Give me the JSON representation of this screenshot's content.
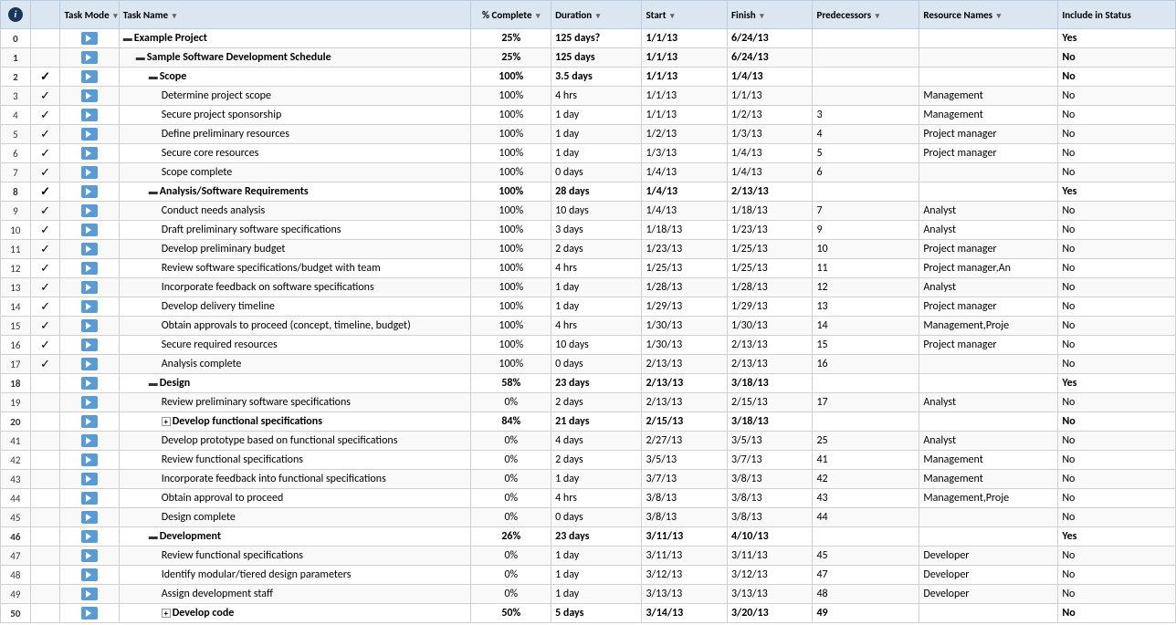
{
  "header": {
    "cols": [
      {
        "id": "col-id",
        "label": ""
      },
      {
        "id": "col-info",
        "label": ""
      },
      {
        "id": "col-task-mode",
        "label": "Task Mode"
      },
      {
        "id": "col-task-name",
        "label": "Task Name"
      },
      {
        "id": "col-pct",
        "label": "% Complete"
      },
      {
        "id": "col-duration",
        "label": "Duration"
      },
      {
        "id": "col-start",
        "label": "Start"
      },
      {
        "id": "col-finish",
        "label": "Finish"
      },
      {
        "id": "col-predecessors",
        "label": "Predecessors"
      },
      {
        "id": "col-resource",
        "label": "Resource Names"
      },
      {
        "id": "col-include",
        "label": "Include in Status"
      }
    ]
  },
  "rows": [
    {
      "id": "0",
      "check": "",
      "mode": "auto",
      "indent": 0,
      "collapse": true,
      "expand_box": false,
      "name": "Example Project",
      "pct": "25%",
      "duration": "125 days?",
      "start": "1/1/13",
      "finish": "6/24/13",
      "predecessors": "",
      "resource": "",
      "include": "Yes",
      "bold": true
    },
    {
      "id": "1",
      "check": "",
      "mode": "auto",
      "indent": 1,
      "collapse": true,
      "expand_box": false,
      "name": "Sample Software Development Schedule",
      "pct": "25%",
      "duration": "125 days",
      "start": "1/1/13",
      "finish": "6/24/13",
      "predecessors": "",
      "resource": "",
      "include": "No",
      "bold": true
    },
    {
      "id": "2",
      "check": "✓",
      "mode": "auto",
      "indent": 2,
      "collapse": true,
      "expand_box": false,
      "name": "Scope",
      "pct": "100%",
      "duration": "3.5 days",
      "start": "1/1/13",
      "finish": "1/4/13",
      "predecessors": "",
      "resource": "",
      "include": "No",
      "bold": true
    },
    {
      "id": "3",
      "check": "✓",
      "mode": "auto",
      "indent": 3,
      "collapse": false,
      "expand_box": false,
      "name": "Determine project scope",
      "pct": "100%",
      "duration": "4 hrs",
      "start": "1/1/13",
      "finish": "1/1/13",
      "predecessors": "",
      "resource": "Management",
      "include": "No",
      "bold": false
    },
    {
      "id": "4",
      "check": "✓",
      "mode": "auto",
      "indent": 3,
      "collapse": false,
      "expand_box": false,
      "name": "Secure project sponsorship",
      "pct": "100%",
      "duration": "1 day",
      "start": "1/1/13",
      "finish": "1/2/13",
      "predecessors": "3",
      "resource": "Management",
      "include": "No",
      "bold": false
    },
    {
      "id": "5",
      "check": "✓",
      "mode": "auto",
      "indent": 3,
      "collapse": false,
      "expand_box": false,
      "name": "Define preliminary resources",
      "pct": "100%",
      "duration": "1 day",
      "start": "1/2/13",
      "finish": "1/3/13",
      "predecessors": "4",
      "resource": "Project manager",
      "include": "No",
      "bold": false
    },
    {
      "id": "6",
      "check": "✓",
      "mode": "auto",
      "indent": 3,
      "collapse": false,
      "expand_box": false,
      "name": "Secure core resources",
      "pct": "100%",
      "duration": "1 day",
      "start": "1/3/13",
      "finish": "1/4/13",
      "predecessors": "5",
      "resource": "Project manager",
      "include": "No",
      "bold": false
    },
    {
      "id": "7",
      "check": "✓",
      "mode": "auto",
      "indent": 3,
      "collapse": false,
      "expand_box": false,
      "name": "Scope complete",
      "pct": "100%",
      "duration": "0 days",
      "start": "1/4/13",
      "finish": "1/4/13",
      "predecessors": "6",
      "resource": "",
      "include": "No",
      "bold": false
    },
    {
      "id": "8",
      "check": "✓",
      "mode": "auto",
      "indent": 2,
      "collapse": true,
      "expand_box": false,
      "name": "Analysis/Software Requirements",
      "pct": "100%",
      "duration": "28 days",
      "start": "1/4/13",
      "finish": "2/13/13",
      "predecessors": "",
      "resource": "",
      "include": "Yes",
      "bold": true
    },
    {
      "id": "9",
      "check": "✓",
      "mode": "auto",
      "indent": 3,
      "collapse": false,
      "expand_box": false,
      "name": "Conduct needs analysis",
      "pct": "100%",
      "duration": "10 days",
      "start": "1/4/13",
      "finish": "1/18/13",
      "predecessors": "7",
      "resource": "Analyst",
      "include": "No",
      "bold": false
    },
    {
      "id": "10",
      "check": "✓",
      "mode": "auto",
      "indent": 3,
      "collapse": false,
      "expand_box": false,
      "name": "Draft preliminary software specifications",
      "pct": "100%",
      "duration": "3 days",
      "start": "1/18/13",
      "finish": "1/23/13",
      "predecessors": "9",
      "resource": "Analyst",
      "include": "No",
      "bold": false
    },
    {
      "id": "11",
      "check": "✓",
      "mode": "auto",
      "indent": 3,
      "collapse": false,
      "expand_box": false,
      "name": "Develop preliminary budget",
      "pct": "100%",
      "duration": "2 days",
      "start": "1/23/13",
      "finish": "1/25/13",
      "predecessors": "10",
      "resource": "Project manager",
      "include": "No",
      "bold": false
    },
    {
      "id": "12",
      "check": "✓",
      "mode": "auto",
      "indent": 3,
      "collapse": false,
      "expand_box": false,
      "name": "Review software specifications/budget with team",
      "pct": "100%",
      "duration": "4 hrs",
      "start": "1/25/13",
      "finish": "1/25/13",
      "predecessors": "11",
      "resource": "Project manager,An",
      "include": "No",
      "bold": false
    },
    {
      "id": "13",
      "check": "✓",
      "mode": "auto",
      "indent": 3,
      "collapse": false,
      "expand_box": false,
      "name": "Incorporate feedback on software specifications",
      "pct": "100%",
      "duration": "1 day",
      "start": "1/28/13",
      "finish": "1/28/13",
      "predecessors": "12",
      "resource": "Analyst",
      "include": "No",
      "bold": false
    },
    {
      "id": "14",
      "check": "✓",
      "mode": "auto",
      "indent": 3,
      "collapse": false,
      "expand_box": false,
      "name": "Develop delivery timeline",
      "pct": "100%",
      "duration": "1 day",
      "start": "1/29/13",
      "finish": "1/29/13",
      "predecessors": "13",
      "resource": "Project manager",
      "include": "No",
      "bold": false
    },
    {
      "id": "15",
      "check": "✓",
      "mode": "auto",
      "indent": 3,
      "collapse": false,
      "expand_box": false,
      "name": "Obtain approvals to proceed (concept, timeline, budget)",
      "pct": "100%",
      "duration": "4 hrs",
      "start": "1/30/13",
      "finish": "1/30/13",
      "predecessors": "14",
      "resource": "Management,Proje",
      "include": "No",
      "bold": false
    },
    {
      "id": "16",
      "check": "✓",
      "mode": "auto",
      "indent": 3,
      "collapse": false,
      "expand_box": false,
      "name": "Secure required resources",
      "pct": "100%",
      "duration": "10 days",
      "start": "1/30/13",
      "finish": "2/13/13",
      "predecessors": "15",
      "resource": "Project manager",
      "include": "No",
      "bold": false
    },
    {
      "id": "17",
      "check": "✓",
      "mode": "auto",
      "indent": 3,
      "collapse": false,
      "expand_box": false,
      "name": "Analysis complete",
      "pct": "100%",
      "duration": "0 days",
      "start": "2/13/13",
      "finish": "2/13/13",
      "predecessors": "16",
      "resource": "",
      "include": "No",
      "bold": false
    },
    {
      "id": "18",
      "check": "",
      "mode": "auto",
      "indent": 2,
      "collapse": true,
      "expand_box": false,
      "name": "Design",
      "pct": "58%",
      "duration": "23 days",
      "start": "2/13/13",
      "finish": "3/18/13",
      "predecessors": "",
      "resource": "",
      "include": "Yes",
      "bold": true
    },
    {
      "id": "19",
      "check": "",
      "mode": "auto",
      "indent": 3,
      "collapse": false,
      "expand_box": false,
      "name": "Review preliminary software specifications",
      "pct": "0%",
      "duration": "2 days",
      "start": "2/13/13",
      "finish": "2/15/13",
      "predecessors": "17",
      "resource": "Analyst",
      "include": "No",
      "bold": false
    },
    {
      "id": "20",
      "check": "",
      "mode": "auto",
      "indent": 3,
      "collapse": false,
      "expand_box": true,
      "name": "Develop functional specifications",
      "pct": "84%",
      "duration": "21 days",
      "start": "2/15/13",
      "finish": "3/18/13",
      "predecessors": "",
      "resource": "",
      "include": "No",
      "bold": true
    },
    {
      "id": "41",
      "check": "",
      "mode": "auto",
      "indent": 3,
      "collapse": false,
      "expand_box": false,
      "name": "Develop prototype based on functional specifications",
      "pct": "0%",
      "duration": "4 days",
      "start": "2/27/13",
      "finish": "3/5/13",
      "predecessors": "25",
      "resource": "Analyst",
      "include": "No",
      "bold": false
    },
    {
      "id": "42",
      "check": "",
      "mode": "auto",
      "indent": 3,
      "collapse": false,
      "expand_box": false,
      "name": "Review functional specifications",
      "pct": "0%",
      "duration": "2 days",
      "start": "3/5/13",
      "finish": "3/7/13",
      "predecessors": "41",
      "resource": "Management",
      "include": "No",
      "bold": false
    },
    {
      "id": "43",
      "check": "",
      "mode": "auto",
      "indent": 3,
      "collapse": false,
      "expand_box": false,
      "name": "Incorporate feedback into functional specifications",
      "pct": "0%",
      "duration": "1 day",
      "start": "3/7/13",
      "finish": "3/8/13",
      "predecessors": "42",
      "resource": "Management",
      "include": "No",
      "bold": false
    },
    {
      "id": "44",
      "check": "",
      "mode": "auto",
      "indent": 3,
      "collapse": false,
      "expand_box": false,
      "name": "Obtain approval to proceed",
      "pct": "0%",
      "duration": "4 hrs",
      "start": "3/8/13",
      "finish": "3/8/13",
      "predecessors": "43",
      "resource": "Management,Proje",
      "include": "No",
      "bold": false
    },
    {
      "id": "45",
      "check": "",
      "mode": "auto",
      "indent": 3,
      "collapse": false,
      "expand_box": false,
      "name": "Design complete",
      "pct": "0%",
      "duration": "0 days",
      "start": "3/8/13",
      "finish": "3/8/13",
      "predecessors": "44",
      "resource": "",
      "include": "No",
      "bold": false
    },
    {
      "id": "46",
      "check": "",
      "mode": "auto",
      "indent": 2,
      "collapse": true,
      "expand_box": false,
      "name": "Development",
      "pct": "26%",
      "duration": "23 days",
      "start": "3/11/13",
      "finish": "4/10/13",
      "predecessors": "",
      "resource": "",
      "include": "Yes",
      "bold": true
    },
    {
      "id": "47",
      "check": "",
      "mode": "auto",
      "indent": 3,
      "collapse": false,
      "expand_box": false,
      "name": "Review functional specifications",
      "pct": "0%",
      "duration": "1 day",
      "start": "3/11/13",
      "finish": "3/11/13",
      "predecessors": "45",
      "resource": "Developer",
      "include": "No",
      "bold": false
    },
    {
      "id": "48",
      "check": "",
      "mode": "auto",
      "indent": 3,
      "collapse": false,
      "expand_box": false,
      "name": "Identify modular/tiered design parameters",
      "pct": "0%",
      "duration": "1 day",
      "start": "3/12/13",
      "finish": "3/12/13",
      "predecessors": "47",
      "resource": "Developer",
      "include": "No",
      "bold": false
    },
    {
      "id": "49",
      "check": "",
      "mode": "auto",
      "indent": 3,
      "collapse": false,
      "expand_box": false,
      "name": "Assign development staff",
      "pct": "0%",
      "duration": "1 day",
      "start": "3/13/13",
      "finish": "3/13/13",
      "predecessors": "48",
      "resource": "Developer",
      "include": "No",
      "bold": false
    },
    {
      "id": "50",
      "check": "",
      "mode": "auto",
      "indent": 3,
      "collapse": false,
      "expand_box": true,
      "name": "Develop code",
      "pct": "50%",
      "duration": "5 days",
      "start": "3/14/13",
      "finish": "3/20/13",
      "predecessors": "49",
      "resource": "",
      "include": "No",
      "bold": true
    }
  ]
}
